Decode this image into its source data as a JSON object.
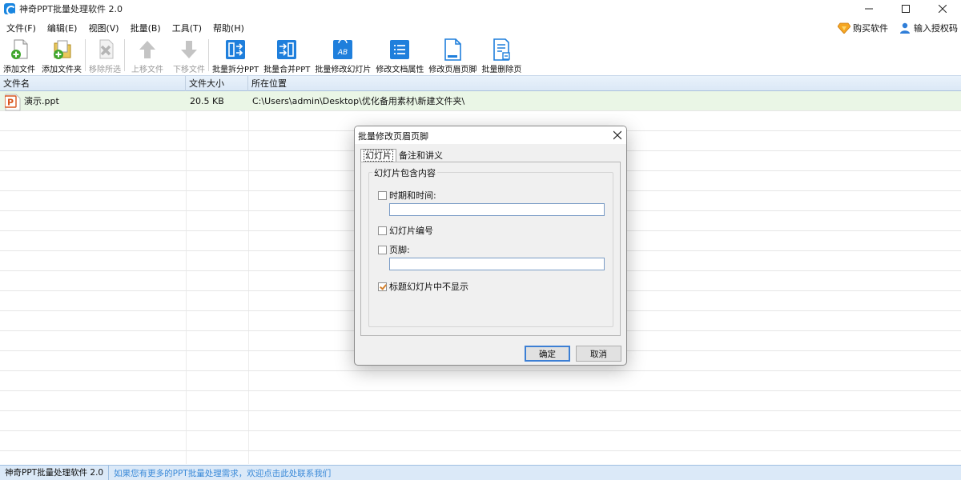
{
  "window": {
    "title": "神奇PPT批量处理软件 2.0"
  },
  "menu": [
    {
      "label": "文件(F)"
    },
    {
      "label": "编辑(E)"
    },
    {
      "label": "视图(V)"
    },
    {
      "label": "批量(B)"
    },
    {
      "label": "工具(T)"
    },
    {
      "label": "帮助(H)"
    }
  ],
  "header_links": {
    "buy": "购买软件",
    "license": "输入授权码"
  },
  "toolbar": [
    {
      "label": "添加文件",
      "icon": "add-file-icon",
      "enabled": true
    },
    {
      "label": "添加文件夹",
      "icon": "add-folder-icon",
      "enabled": true
    },
    {
      "label": "移除所选",
      "icon": "remove-icon",
      "enabled": false
    },
    {
      "label": "上移文件",
      "icon": "arrow-up-icon",
      "enabled": false
    },
    {
      "label": "下移文件",
      "icon": "arrow-down-icon",
      "enabled": false
    },
    {
      "label": "批量拆分PPT",
      "icon": "split-icon",
      "enabled": true
    },
    {
      "label": "批量合并PPT",
      "icon": "merge-icon",
      "enabled": true
    },
    {
      "label": "批量修改幻灯片",
      "icon": "ab-slide-icon",
      "enabled": true
    },
    {
      "label": "修改文档属性",
      "icon": "properties-icon",
      "enabled": true
    },
    {
      "label": "修改页眉页脚",
      "icon": "header-footer-icon",
      "enabled": true
    },
    {
      "label": "批量删除页",
      "icon": "delete-page-icon",
      "enabled": true
    }
  ],
  "grid": {
    "columns": [
      "文件名",
      "文件大小",
      "所在位置"
    ],
    "rows": [
      {
        "name": "演示.ppt",
        "size": "20.5 KB",
        "path": "C:\\Users\\admin\\Desktop\\优化备用素材\\新建文件夹\\"
      }
    ]
  },
  "status": {
    "app": "神奇PPT批量处理软件 2.0",
    "message": "如果您有更多的PPT批量处理需求，欢迎点击此处联系我们"
  },
  "dialog": {
    "title": "批量修改页眉页脚",
    "tabs": [
      "幻灯片",
      "备注和讲义"
    ],
    "group_title": "幻灯片包含内容",
    "date_label": "时期和时间:",
    "date_value": "",
    "number_label": "幻灯片编号",
    "footer_label": "页脚:",
    "footer_value": "",
    "title_hide_label": "标题幻灯片中不显示",
    "ok": "确定",
    "cancel": "取消"
  },
  "colors": {
    "accent": "#1a86e0",
    "selected_row": "#eaf6e6",
    "status_bar": "#dbe9f8",
    "link": "#3b8ad8"
  }
}
